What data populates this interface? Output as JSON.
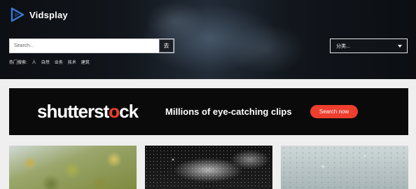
{
  "header": {
    "logo_text": "Vidsplay",
    "logo_icon": "play-triangle-icon"
  },
  "search": {
    "placeholder": "Search...",
    "button_label": "去"
  },
  "hot_searches": {
    "label": "热门搜索:",
    "items": [
      "人",
      "自然",
      "业务",
      "技术",
      "建筑"
    ]
  },
  "category": {
    "selected": "分类..."
  },
  "ad": {
    "brand_prefix": "shutterst",
    "brand_o": "o",
    "brand_suffix": "ck",
    "tagline": "Millions of eye-catching clips",
    "button_label": "Search now",
    "accent_color": "#ee3e2e"
  },
  "colors": {
    "accent": "#ee3e2e",
    "page_background": "#efefef"
  }
}
